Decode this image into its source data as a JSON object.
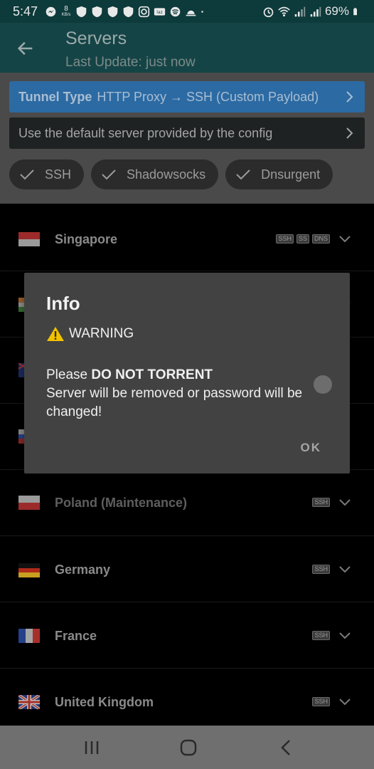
{
  "status_bar": {
    "time": "5:47",
    "speed_value": "8",
    "speed_unit": "KB/s",
    "battery": "69%",
    "icons": [
      "messenger-icon",
      "shield-icon",
      "shield-icon",
      "shield-icon",
      "shield-icon",
      "instagram-icon",
      "lazada-icon",
      "spotify-icon",
      "weather-icon",
      "dot-icon",
      "alarm-icon",
      "wifi-icon",
      "signal-icon",
      "signal-icon",
      "battery-icon"
    ]
  },
  "appbar": {
    "title": "Servers",
    "subtitle": "Last Update: just now"
  },
  "tunnel": {
    "label": "Tunnel Type",
    "value": "HTTP Proxy → SSH (Custom Payload)"
  },
  "server_select": {
    "text": "Use the default server provided by the config"
  },
  "chips": [
    {
      "label": "SSH"
    },
    {
      "label": "Shadowsocks"
    },
    {
      "label": "Dnsurgent"
    }
  ],
  "servers": [
    {
      "name": "Singapore",
      "tags": [
        "SSH",
        "SS",
        "DNS"
      ],
      "flag": "singapore"
    },
    {
      "name": "",
      "tags": [],
      "flag": "india"
    },
    {
      "name": "",
      "tags": [],
      "flag": "australia"
    },
    {
      "name": "",
      "tags": [],
      "flag": "russia"
    },
    {
      "name": "Poland (Maintenance)",
      "tags": [
        "SSH"
      ],
      "flag": "poland"
    },
    {
      "name": "Germany",
      "tags": [
        "SSH"
      ],
      "flag": "germany"
    },
    {
      "name": "France",
      "tags": [
        "SSH"
      ],
      "flag": "france"
    },
    {
      "name": "United Kingdom",
      "tags": [
        "SSH"
      ],
      "flag": "uk"
    }
  ],
  "dialog": {
    "title": "Info",
    "warning": "WARNING",
    "msg_prefix": "Please ",
    "msg_bold": "DO NOT TORRENT",
    "msg_rest": "Server will be removed or password will be changed!",
    "ok_label": "OK"
  },
  "colors": {
    "statusbar_bg": "#0d3a3b",
    "appbar_bg": "#154446",
    "tunnel_bg": "#2c6aa3",
    "dialog_bg": "#424242"
  }
}
